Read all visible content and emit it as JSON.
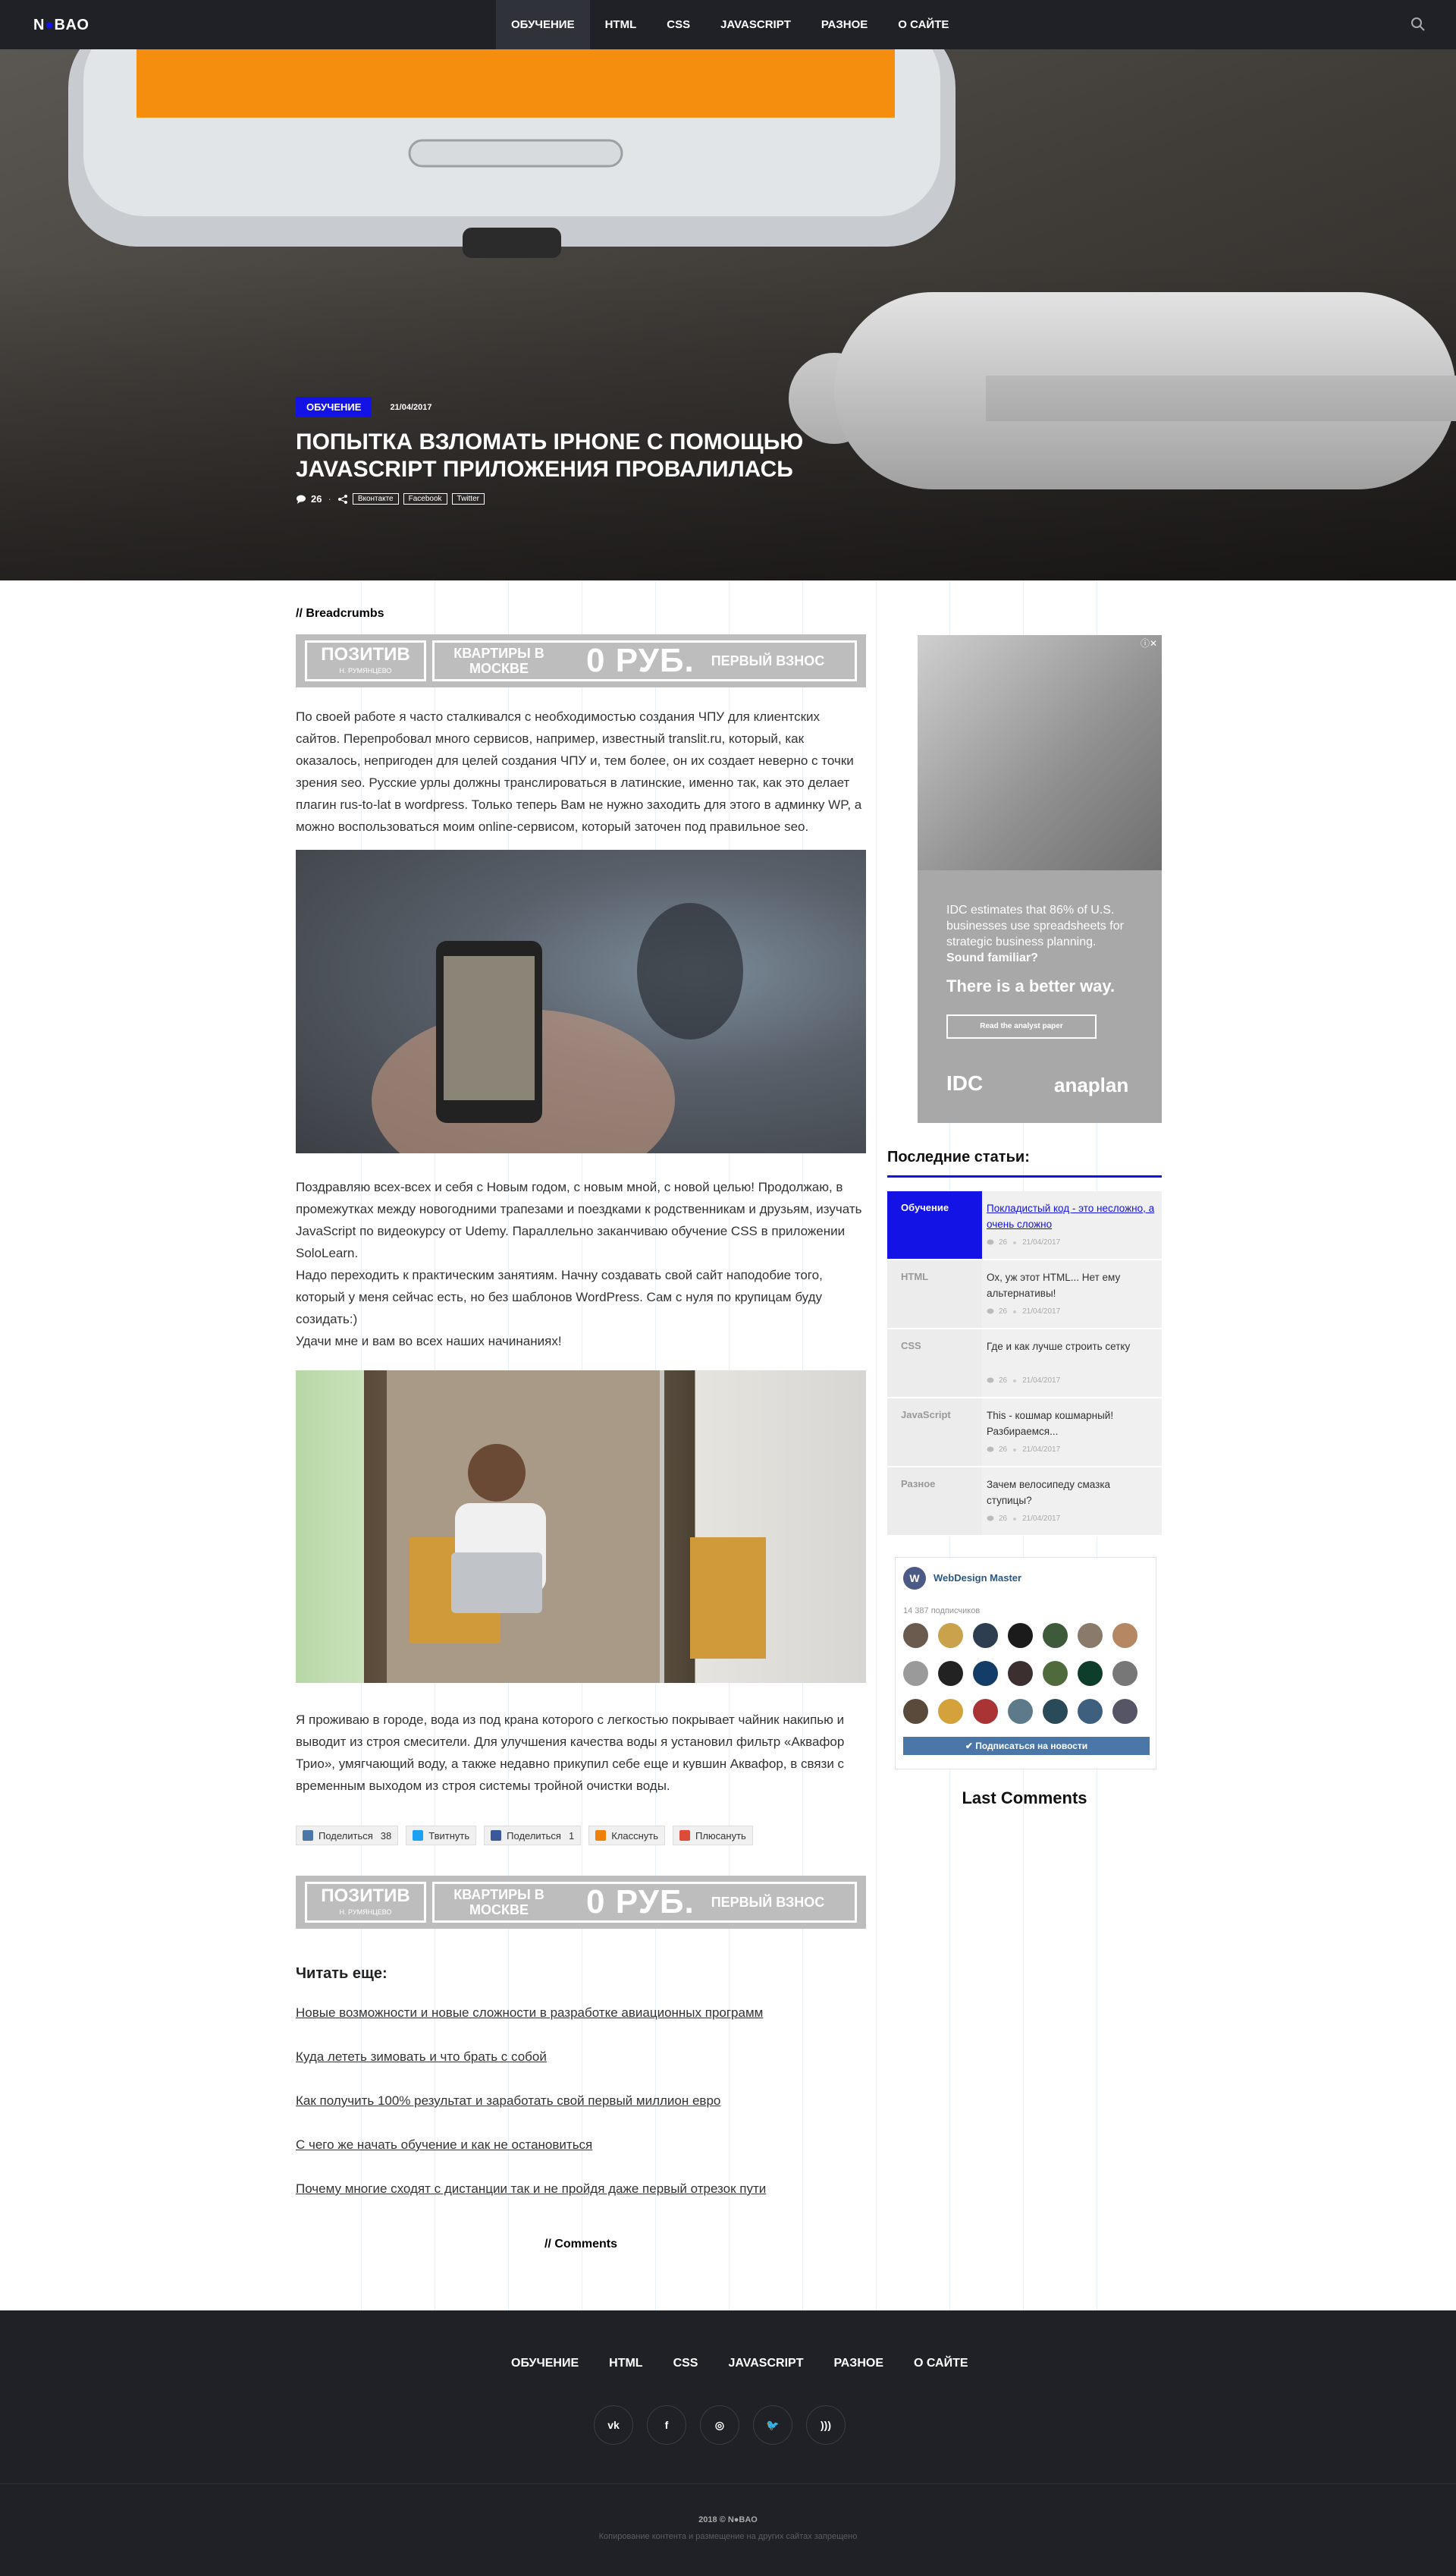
{
  "header": {
    "logo_left": "N",
    "logo_mid": "●",
    "logo_right": "BAO",
    "nav": [
      "ОБУЧЕНИЕ",
      "HTML",
      "CSS",
      "JAVASCRIPT",
      "РАЗНОЕ",
      "О САЙТЕ"
    ],
    "active_nav": "ОБУЧЕНИЕ",
    "search_icon": "search-icon"
  },
  "hero": {
    "category": "Обучение",
    "date": "21/04/2017",
    "title": "Попытка взломать iPhone с помощью JavaScript приложения провалилась",
    "comments": "26",
    "share": [
      "Вконтакте",
      "Facebook",
      "Twitter"
    ]
  },
  "article": {
    "breadcrumbs": "// Breadcrumbs",
    "ad": {
      "brand": "ПОЗИТИВ",
      "brand_sub": "Н. РУМЯНЦЕВО",
      "a": "Квартиры в Москве",
      "b": "0 РУБ.",
      "c": "Первый взнос"
    },
    "p1": "По своей работе я часто сталкивался с необходимостью создания ЧПУ для клиентских сайтов. Перепробовал много сервисов, например, известный translit.ru, который, как оказалось, непригоден для целей создания ЧПУ и, тем более, он их создает неверно с точки зрения seo. Русские урлы должны транслироваться в латинские, именно так, как это делает плагин rus-to-lat в wordpress. Только теперь Вам не нужно заходить для этого в админку WP, а можно воспользоваться моим online-сервисом, который заточен под правильное seo.",
    "p2a": "Поздравляю всех-всех и себя с Новым годом, с новым мной, с новой целью! Продолжаю, в промежутках между новогодними трапезами и поездками к родственникам и друзьям, изучать JavaScript по видеокурсу от Udemy. Параллельно заканчиваю обучение CSS в приложении SoloLearn.",
    "p2b": "Надо переходить к практическим занятиям. Начну создавать свой сайт наподобие того, который у меня сейчас есть, но без шаблонов WordPress. Сам с нуля по крупицам буду созидать:)",
    "p2c": "Удачи мне и вам во всех наших начинаниях!",
    "p3": "Я проживаю в городе, вода из под крана которого с легкостью покрывает чайник накипью и выводит из строя смесители. Для улучшения качества воды я установил фильтр «Аквафор Трио», умягчающий воду, а также недавно прикупил себе еще и кувшин Аквафор, в связи с временным выходом из строя системы тройной очистки воды.",
    "share_buttons": [
      {
        "label": "Поделиться",
        "count": "38",
        "color": "#4a76a8",
        "icon": "vk-icon"
      },
      {
        "label": "Твитнуть",
        "count": "",
        "color": "#1da1f2",
        "icon": "twitter-icon"
      },
      {
        "label": "Поделиться",
        "count": "1",
        "color": "#3b5998",
        "icon": "facebook-icon"
      },
      {
        "label": "Класснуть",
        "count": "",
        "color": "#ee8208",
        "icon": "odnoklassniki-icon"
      },
      {
        "label": "Плюсануть",
        "count": "",
        "color": "#dd4b39",
        "icon": "google-plus-icon"
      }
    ],
    "read_more_title": "Читать еще:",
    "read_more": [
      "Новые возможности и новые сложности в разработке авиационных программ",
      "Куда лететь зимовать и что брать с собой",
      "Как получить 100% результат и заработать свой первый миллион евро",
      "С чего же начать обучение и как не остановиться",
      "Почему многие сходят с дистанции так и не пройдя даже первый отрезок пути"
    ],
    "comments_label": "// Comments"
  },
  "sidebar": {
    "ad": {
      "text": "IDC estimates that 86% of U.S. businesses use spreadsheets for strategic business planning.",
      "strong": "Sound familiar?",
      "head": "There is a better way.",
      "button": "Read the analyst paper",
      "logo1": "IDC",
      "logo2": "anaplan",
      "close": "ⓘ✕"
    },
    "latest_title": "Последние статьи:",
    "latest": [
      {
        "cat": "Обучение",
        "title": "Покладистый код - это несложно, а очень сложно",
        "comments": "26",
        "date": "21/04/2017",
        "active": true
      },
      {
        "cat": "HTML",
        "title": "Ох, уж этот HTML... Нет ему альтернативы!",
        "comments": "26",
        "date": "21/04/2017",
        "active": false
      },
      {
        "cat": "CSS",
        "title": "Где и как лучше строить сетку",
        "comments": "26",
        "date": "21/04/2017",
        "active": false
      },
      {
        "cat": "JavaScript",
        "title": "This - кошмар кошмарный! Разбираемся...",
        "comments": "26",
        "date": "21/04/2017",
        "active": false
      },
      {
        "cat": "Разное",
        "title": "Зачем велосипеду смазка ступицы?",
        "comments": "26",
        "date": "21/04/2017",
        "active": false
      }
    ],
    "vk": {
      "name": "WebDesign Master",
      "subscribers": "14 387 подписчиков",
      "button": "Подписаться на новости",
      "face_colors": [
        "#6b5b4f",
        "#c9a24b",
        "#2c3e50",
        "#1b1b1b",
        "#3d5a3a",
        "#8a7a6a",
        "#b58863",
        "#9a9a9a",
        "#222",
        "#133c66",
        "#3c2f2f",
        "#4f6b3d",
        "#0f3d2b",
        "#777",
        "#5a4a3a",
        "#d4a13a",
        "#a33",
        "#5d7a8a",
        "#2a4a5a",
        "#3f5f7f",
        "#556"
      ]
    },
    "last_comments": "Last Comments"
  },
  "footer": {
    "nav": [
      "ОБУЧЕНИЕ",
      "HTML",
      "CSS",
      "JAVASCRIPT",
      "РАЗНОЕ",
      "О САЙТЕ"
    ],
    "social": [
      "vk-icon",
      "facebook-icon",
      "instagram-icon",
      "twitter-icon",
      "rss-icon"
    ],
    "copyright": "2018 © N●BAO",
    "note": "Копирование контента и размещение на других сайтах запрещено"
  }
}
